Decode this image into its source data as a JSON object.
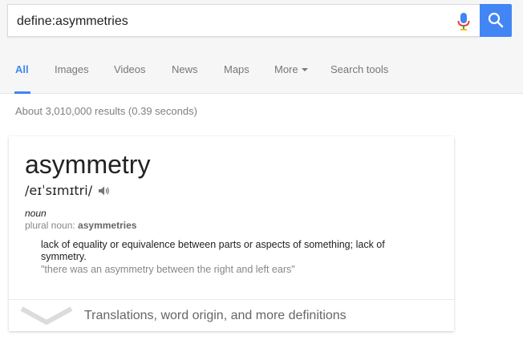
{
  "search": {
    "query": "define:asymmetries"
  },
  "tabs": [
    {
      "label": "All"
    },
    {
      "label": "Images"
    },
    {
      "label": "Videos"
    },
    {
      "label": "News"
    },
    {
      "label": "Maps"
    },
    {
      "label": "More"
    },
    {
      "label": "Search tools"
    }
  ],
  "stats": "About 3,010,000 results (0.39 seconds)",
  "definition_card": {
    "word": "asymmetry",
    "phonetic": "/eɪˈsɪmɪtri/",
    "part_of_speech": "noun",
    "plural_label": "plural noun: ",
    "plural_word": "asymmetries",
    "definition": "lack of equality or equivalence between parts or aspects of something; lack of symmetry.",
    "example": "\"there was an asymmetry between the right and left ears\"",
    "more_link": "Translations, word origin, and more definitions"
  },
  "colors": {
    "accent": "#4285f4",
    "muted": "#777777",
    "text": "#222222"
  },
  "icons": [
    "mic-icon",
    "search-icon",
    "caret-down-icon",
    "speaker-icon",
    "chevron-down-icon"
  ]
}
